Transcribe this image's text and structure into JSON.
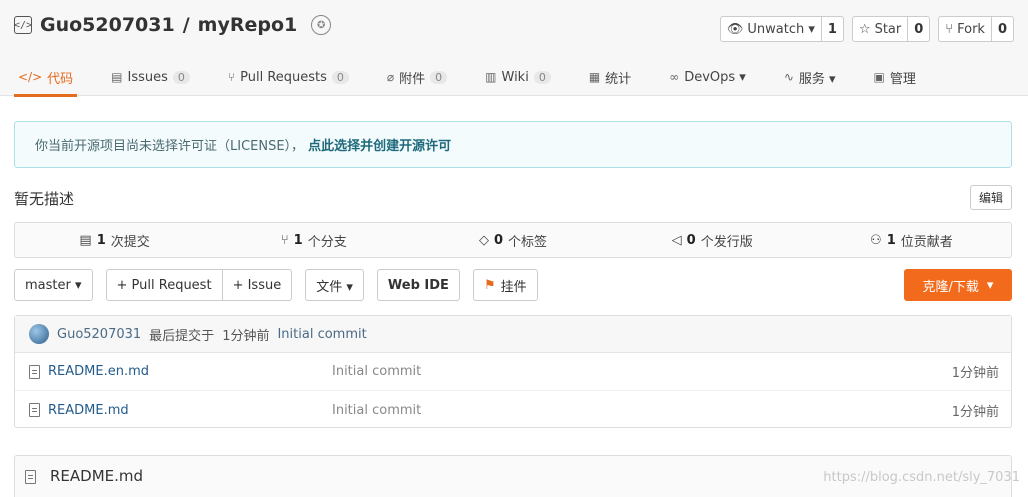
{
  "repo": {
    "owner": "Guo5207031",
    "separator": " / ",
    "name": "myRepo1"
  },
  "actions": [
    {
      "label": "Unwatch ▾",
      "count": "1",
      "icon": "eye-icon"
    },
    {
      "label": "Star",
      "count": "0",
      "icon": "star-icon"
    },
    {
      "label": "Fork",
      "count": "0",
      "icon": "fork-icon"
    }
  ],
  "tabs": [
    {
      "label": "代码",
      "count": "",
      "icon": "code-icon"
    },
    {
      "label": "Issues",
      "count": "0",
      "icon": "issues-icon"
    },
    {
      "label": "Pull Requests",
      "count": "0",
      "icon": "pull-request-icon"
    },
    {
      "label": "附件",
      "count": "0",
      "icon": "paperclip-icon"
    },
    {
      "label": "Wiki",
      "count": "0",
      "icon": "book-icon"
    },
    {
      "label": "统计",
      "count": "",
      "icon": "chart-icon"
    },
    {
      "label": "DevOps ▾",
      "count": "",
      "icon": "infinity-icon"
    },
    {
      "label": "服务 ▾",
      "count": "",
      "icon": "pulse-icon"
    },
    {
      "label": "管理",
      "count": "",
      "icon": "settings-doc-icon"
    }
  ],
  "license": {
    "text": "你当前开源项目尚未选择许可证（LICENSE），",
    "link": "点此选择并创建开源许可"
  },
  "description": "暂无描述",
  "edit_label": "编辑",
  "stats": [
    {
      "value": "1",
      "label": "次提交",
      "icon": "commit-icon"
    },
    {
      "value": "1",
      "label": "个分支",
      "icon": "branch-icon"
    },
    {
      "value": "0",
      "label": "个标签",
      "icon": "tag-icon"
    },
    {
      "value": "0",
      "label": "个发行版",
      "icon": "release-icon"
    },
    {
      "value": "1",
      "label": "位贡献者",
      "icon": "contributors-icon"
    }
  ],
  "toolbar": {
    "branch": "master ▾",
    "pull_request": "+ Pull Request",
    "issue": "+ Issue",
    "files": "文件 ▾",
    "web_ide": "Web IDE",
    "widget": "挂件",
    "clone": "克隆/下载",
    "clone_caret": "▾"
  },
  "commit": {
    "user": "Guo5207031",
    "label": "最后提交于",
    "time": "1分钟前",
    "message": "Initial commit"
  },
  "files": [
    {
      "name": "README.en.md",
      "commit": "Initial commit",
      "time": "1分钟前"
    },
    {
      "name": "README.md",
      "commit": "Initial commit",
      "time": "1分钟前"
    }
  ],
  "readme_title": "README.md",
  "watermark": "https://blog.csdn.net/sly_7031"
}
